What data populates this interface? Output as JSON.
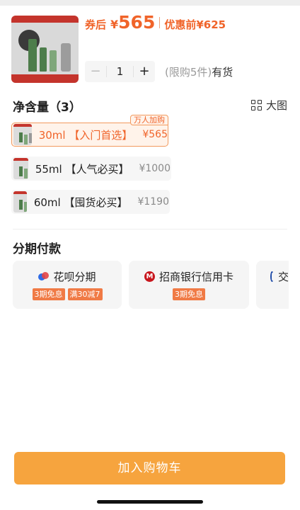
{
  "product": {
    "after_coupon_label": "券后",
    "currency": "¥",
    "after_coupon_price": "565",
    "before_label": "优惠前",
    "before_price": "¥625"
  },
  "quantity": {
    "minus": "−",
    "value": "1",
    "plus": "+",
    "limit_text": "(限购5件)",
    "stock_text": "有货"
  },
  "sizes": {
    "title": "净含量（3）",
    "view_toggle_label": "大图",
    "options": [
      {
        "label": "30ml 【入门首选】",
        "price": "¥565",
        "tag": "万人加购",
        "selected": true
      },
      {
        "label": "55ml 【人气必买】",
        "price": "¥1000",
        "selected": false
      },
      {
        "label": "60ml 【囤货必买】",
        "price": "¥1190",
        "selected": false
      }
    ]
  },
  "installment": {
    "title": "分期付款",
    "cards": [
      {
        "name": "花呗分期",
        "icon": "huabei-icon",
        "badges": [
          "3期免息",
          "满30减7"
        ]
      },
      {
        "name": "招商银行信用卡",
        "icon": "cmb-bank-icon",
        "badges": [
          "3期免息"
        ]
      },
      {
        "name": "交",
        "icon": "bank-icon",
        "badges": []
      }
    ]
  },
  "cta": {
    "label": "加入购物车"
  },
  "colors": {
    "accent": "#f0642a",
    "cta": "#f6a43e",
    "badge": "#f07a45"
  }
}
